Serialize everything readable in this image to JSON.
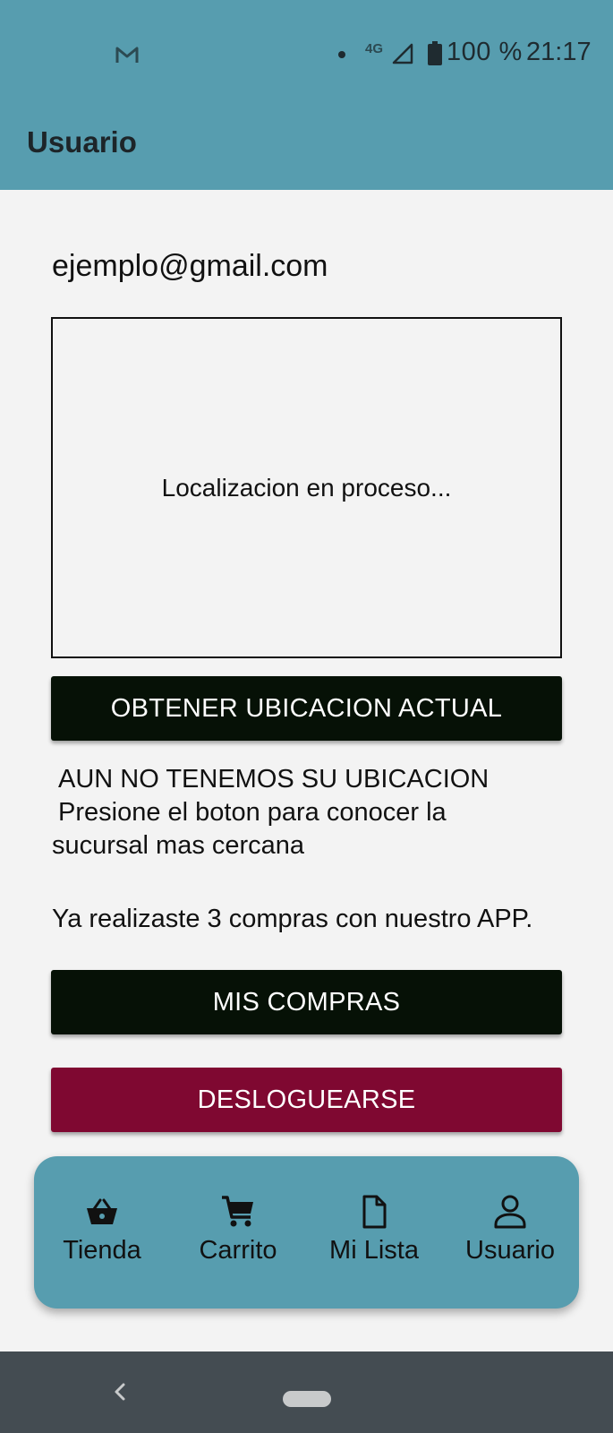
{
  "status_bar": {
    "network": "4G",
    "battery": "100 %",
    "time": "21:17",
    "icons": [
      "gmail-icon",
      "notification-dot-icon",
      "signal-icon",
      "battery-icon"
    ]
  },
  "app_bar": {
    "title": "Usuario"
  },
  "user": {
    "email": "ejemplo@gmail.com"
  },
  "map": {
    "status": "Localizacion en proceso..."
  },
  "location": {
    "button_label": "OBTENER UBICACION ACTUAL",
    "status_line1": "AUN NO TENEMOS SU UBICACION",
    "status_line2": "Presione el boton para conocer la",
    "status_line3": "sucursal mas cercana"
  },
  "purchases": {
    "summary": "Ya realizaste 3 compras con nuestro APP.",
    "count": 3,
    "button_label": "MIS COMPRAS"
  },
  "logout": {
    "button_label": "DESLOGUEARSE"
  },
  "bottom_nav": {
    "items": [
      {
        "label": "Tienda",
        "icon": "basket-icon"
      },
      {
        "label": "Carrito",
        "icon": "cart-icon"
      },
      {
        "label": "Mi Lista",
        "icon": "document-icon"
      },
      {
        "label": "Usuario",
        "icon": "user-icon"
      }
    ]
  },
  "colors": {
    "primary": "#579daf",
    "button_dark": "#061106",
    "button_red": "#7f0831",
    "background": "#f3f3f3",
    "system_nav": "#444c52"
  }
}
